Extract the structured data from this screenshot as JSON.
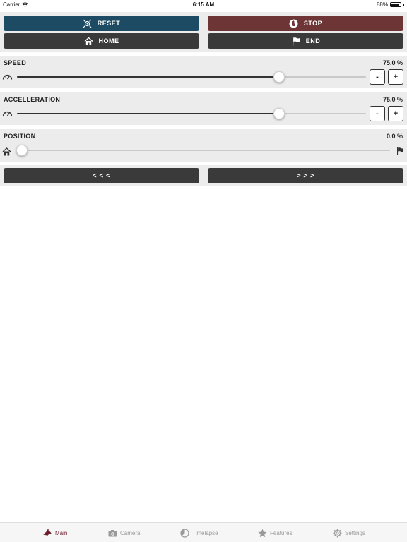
{
  "status_bar": {
    "carrier": "Carrier",
    "time": "6:15 AM",
    "battery": "88%",
    "battery_level": 0.88
  },
  "controls": {
    "reset_label": "RESET",
    "stop_label": "STOP",
    "home_label": "HOME",
    "end_label": "END"
  },
  "speed": {
    "label": "SPEED",
    "value_text": "75.0 %",
    "level": 0.75,
    "minus": "-",
    "plus": "+"
  },
  "acceleration": {
    "label": "ACCELLERATION",
    "value_text": "75.0 %",
    "level": 0.75,
    "minus": "-",
    "plus": "+"
  },
  "position": {
    "label": "POSITION",
    "value_text": "0.0 %",
    "level": 0.0
  },
  "nav": {
    "back_label": "< < <",
    "forward_label": "> > >"
  },
  "tabs": [
    {
      "label": "Main",
      "icon": "bird-icon",
      "active": true
    },
    {
      "label": "Camera",
      "icon": "camera-icon",
      "active": false
    },
    {
      "label": "Timelapse",
      "icon": "timelapse-icon",
      "active": false
    },
    {
      "label": "Features",
      "icon": "star-icon",
      "active": false
    },
    {
      "label": "Settings",
      "icon": "gear-icon",
      "active": false
    }
  ],
  "colors": {
    "reset": "#1d4b63",
    "stop": "#6e3537",
    "dark_button": "#3a3a3a",
    "active_tab": "#6b1d2c",
    "panel": "#ececec"
  }
}
